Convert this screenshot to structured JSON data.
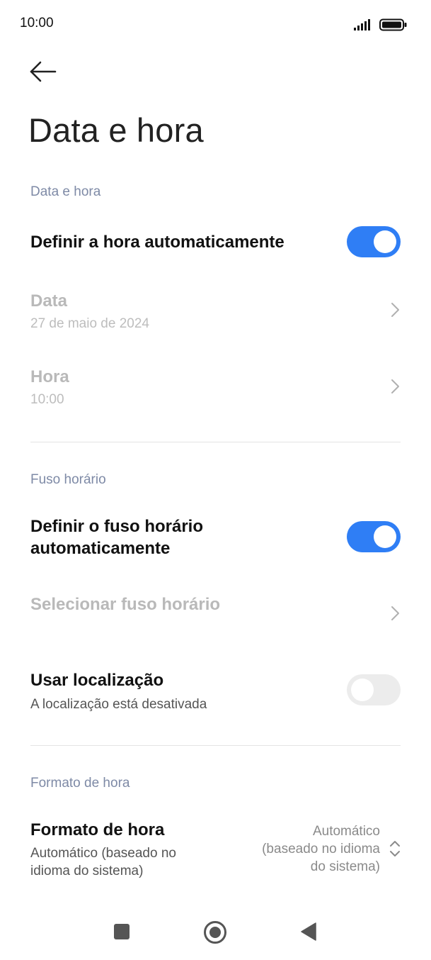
{
  "status_bar": {
    "time": "10:00",
    "signal_icon": "signal-icon",
    "battery_icon": "battery-icon"
  },
  "header": {
    "back_icon": "back-arrow-icon",
    "title": "Data e hora"
  },
  "sections": {
    "date_time": {
      "header": "Data e hora",
      "auto_time": {
        "label": "Definir a hora automaticamente",
        "enabled": true
      },
      "date": {
        "label": "Data",
        "value": "27 de maio de 2024"
      },
      "time": {
        "label": "Hora",
        "value": "10:00"
      }
    },
    "time_zone": {
      "header": "Fuso horário",
      "auto_zone": {
        "label": "Definir o fuso horário automaticamente",
        "line1": "Definir o fuso horário",
        "line2": "automaticamente",
        "enabled": true
      },
      "select_zone": {
        "label": "Selecionar fuso horário"
      },
      "use_location": {
        "label": "Usar localização",
        "sub": "A localização está desativada",
        "enabled": false
      }
    },
    "time_format": {
      "header": "Formato de hora",
      "format": {
        "label": "Formato de hora",
        "sub_line1": "Automático (baseado no",
        "sub_line2": "idioma do sistema)",
        "value_line1": "Automático",
        "value_line2": "(baseado no idioma",
        "value_line3": "do sistema)"
      }
    }
  },
  "nav_bar": {
    "recents_icon": "square-recents-icon",
    "home_icon": "circle-home-icon",
    "back_icon": "triangle-back-icon"
  },
  "colors": {
    "accent": "#2f7ef5",
    "section_header": "#7e8aa6",
    "disabled_text": "#b9b9b9"
  }
}
